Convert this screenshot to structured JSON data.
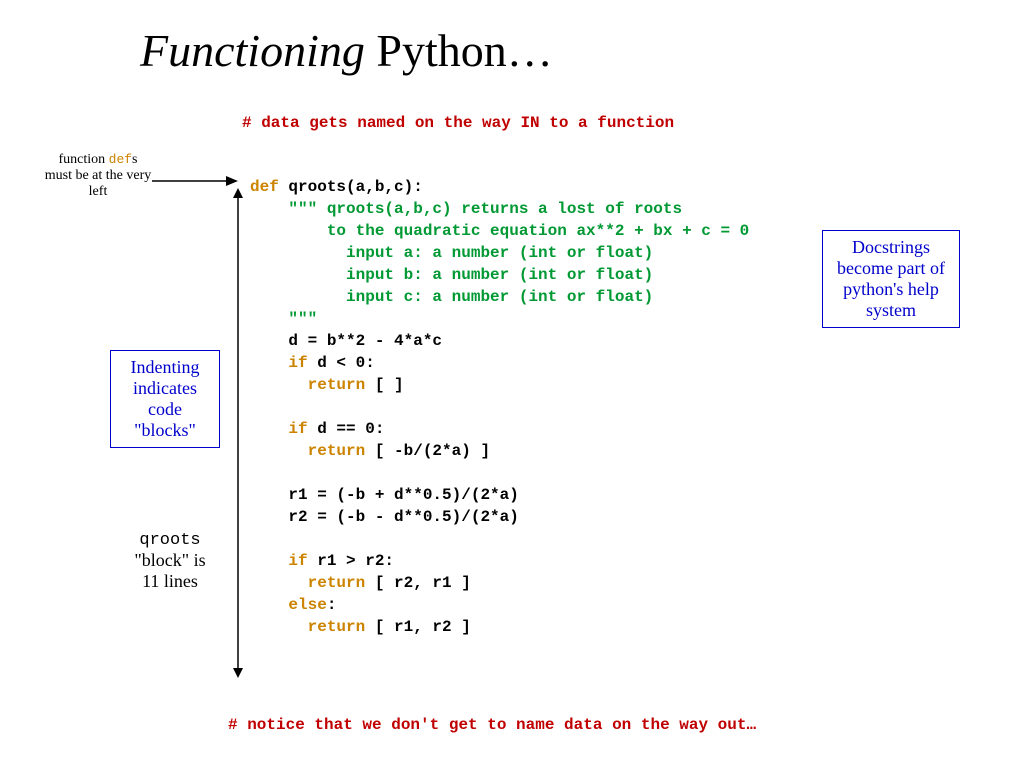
{
  "title": {
    "ital": "Functioning",
    "rest": " Python…"
  },
  "topComment": "# data gets named on the way IN to a function",
  "sidenote": {
    "defs_pre": "function ",
    "defs_kw": "def",
    "defs_post": "s must be at the very left"
  },
  "indentBox": "Indenting indicates code \"blocks\"",
  "qrootsBlock": {
    "l1_pre": "qroots",
    "l2": "\"block\" is",
    "l3": "11 lines"
  },
  "docstrBox": "Docstrings become part of python's help system",
  "bottomComment": "# notice that we don't get to name data on the way out…",
  "code": {
    "l1a": "def",
    "l1b": " qroots(a,b,c):",
    "l2": "    \"\"\" qroots(a,b,c) returns a lost of roots",
    "l3": "        to the quadratic equation ax**2 + bx + c = 0",
    "l4": "          input a: a number (int or float)",
    "l5": "          input b: a number (int or float)",
    "l6": "          input c: a number (int or float)",
    "l7": "    \"\"\"",
    "l8": "    d = b**2 - 4*a*c",
    "l9a": "    ",
    "l9b": "if",
    "l9c": " d < 0:",
    "l10a": "      ",
    "l10b": "return",
    "l10c": " [ ]",
    "blank": "",
    "l12a": "    ",
    "l12b": "if",
    "l12c": " d == 0:",
    "l13a": "      ",
    "l13b": "return",
    "l13c": " [ -b/(2*a) ]",
    "l15": "    r1 = (-b + d**0.5)/(2*a)",
    "l16": "    r2 = (-b - d**0.5)/(2*a)",
    "l18a": "    ",
    "l18b": "if",
    "l18c": " r1 > r2:",
    "l19a": "      ",
    "l19b": "return",
    "l19c": " [ r2, r1 ]",
    "l20a": "    ",
    "l20b": "else",
    "l20c": ":",
    "l21a": "      ",
    "l21b": "return",
    "l21c": " [ r1, r2 ]"
  }
}
